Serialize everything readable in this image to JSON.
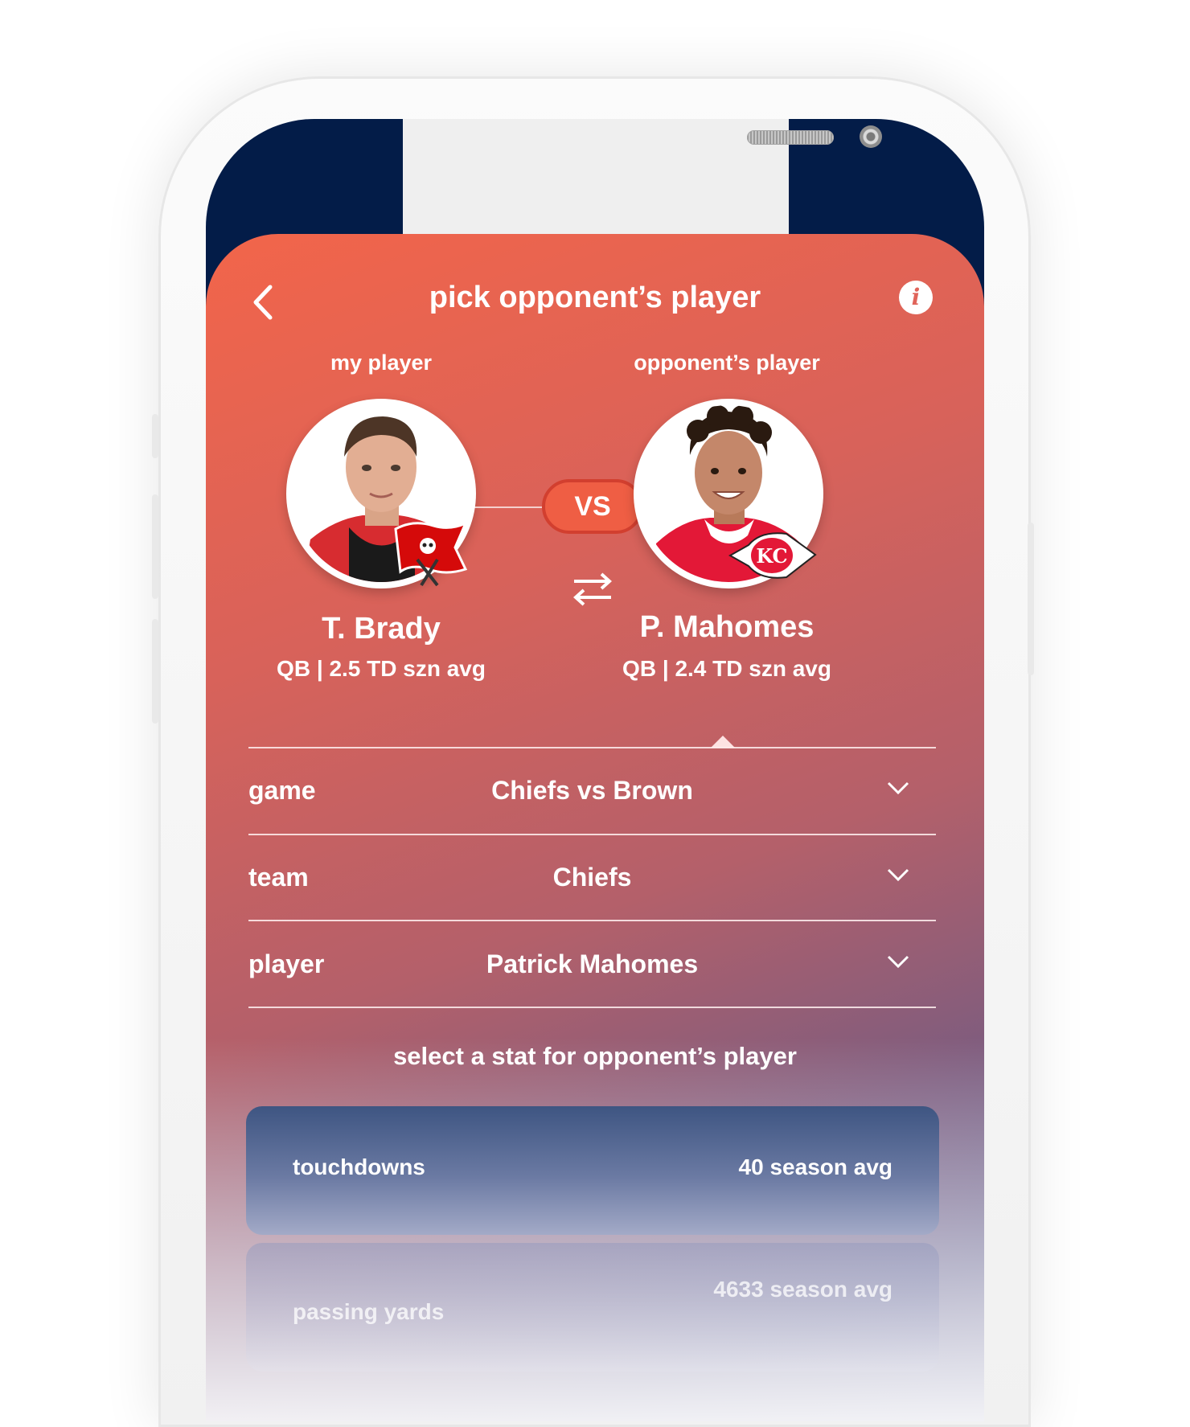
{
  "header": {
    "title": "pick opponent’s player"
  },
  "labels": {
    "my_player": "my player",
    "opponent_player": "opponent’s player"
  },
  "vs": "VS",
  "my_player": {
    "name": "T. Brady",
    "stat": "QB | 2.5 TD szn avg",
    "team_logo": "buccaneers-logo"
  },
  "opponent": {
    "name": "P. Mahomes",
    "stat": "QB | 2.4 TD szn avg",
    "team_logo": "chiefs-logo"
  },
  "filters": [
    {
      "label": "game",
      "value": "Chiefs vs Brown"
    },
    {
      "label": "team",
      "value": "Chiefs"
    },
    {
      "label": "player",
      "value": "Patrick Mahomes"
    }
  ],
  "stats_title": "select a stat for opponent’s player",
  "stats": [
    {
      "label": "touchdowns",
      "value": "40 season avg"
    },
    {
      "label": "passing yards",
      "value": "4633  season avg"
    }
  ],
  "colors": {
    "navy": "#031c48",
    "accent": "#ef5e44",
    "white": "#ffffff"
  }
}
